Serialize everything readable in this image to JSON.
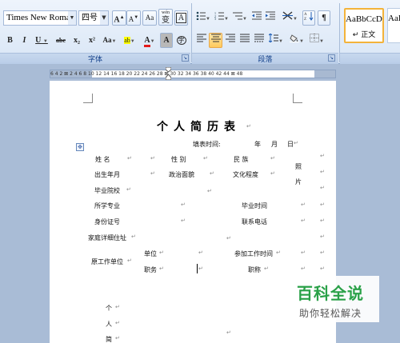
{
  "font_group": {
    "font_name": "Times New Romar",
    "font_size": "四号",
    "caption": "字体",
    "grow_font": "A",
    "shrink_font": "A",
    "clear_format": "Aa",
    "phonetic": "wén",
    "phonetic_char": "变",
    "char_border": "A",
    "bold": "B",
    "italic": "I",
    "underline": "U",
    "strikethrough": "abe",
    "subscript": "x₂",
    "superscript": "x²",
    "change_case": "Aa",
    "highlight": "ab",
    "font_color": "A",
    "char_shading": "A",
    "enclose": "字"
  },
  "paragraph_group": {
    "caption": "段落"
  },
  "styles_group": {
    "style1_sample": "AaBbCcDc",
    "style1_name": "↵ 正文",
    "style2_sample": "AaB"
  },
  "ruler": {
    "labels": "6  4  2  ⊠  2  4  6  8 10 12 14 16 18  20  22 24 26 28  ⊠ 30 32 34 36 38 40 42 44 ⊠ 48"
  },
  "document": {
    "title": "个人简历表",
    "fill_time_label": "填表时间:",
    "year": "年",
    "month": "月",
    "day": "日",
    "name_label": "姓    名",
    "gender_label": "性    别",
    "ethnic_label": "民    族",
    "birth_label": "出生年月",
    "political_label": "政治面貌",
    "education_label": "文化程度",
    "photo_label_1": "照",
    "photo_label_2": "片",
    "school_label": "毕业院校",
    "major_label": "所学专业",
    "grad_time_label": "毕业时间",
    "id_label": "身份证号",
    "phone_label": "联系电话",
    "address_label": "家庭详细住址",
    "work_unit_label": "原工作单位",
    "unit_label": "单位",
    "job_label": "职务",
    "join_time_label": "参加工作时间",
    "title_label": "职称",
    "resume_1": "个",
    "resume_2": "人",
    "resume_3": "简"
  },
  "watermark": {
    "title": "百科全说",
    "subtitle": "助你轻松解决"
  }
}
